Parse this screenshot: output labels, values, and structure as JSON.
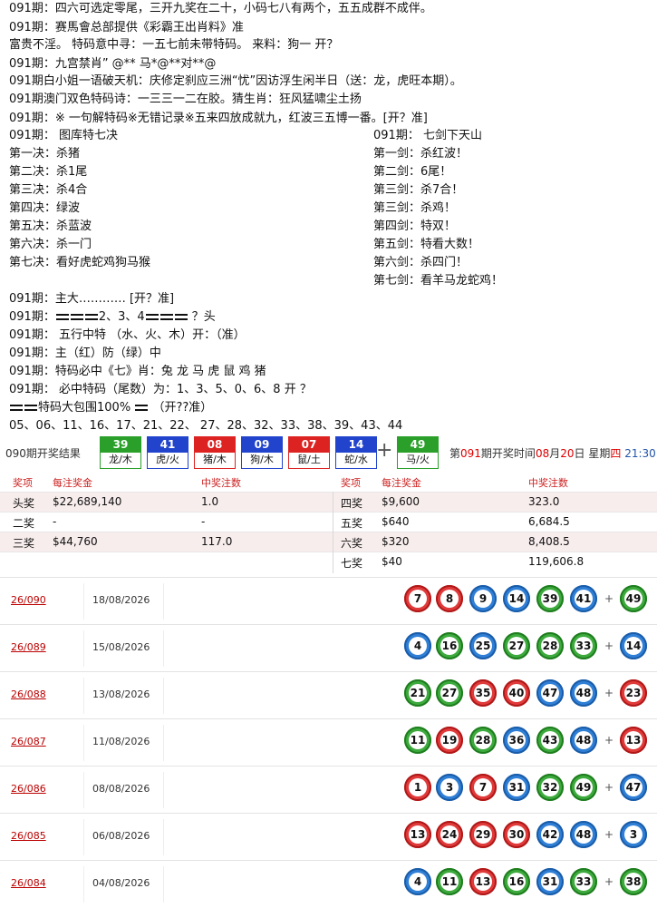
{
  "lines": [
    "091期：四六可选定零尾，三开九奖在二十，小码七八有两个，五五成群不成伴。",
    "091期：赛馬會总部提供《彩霸王出肖料》准",
    "富贵不淫。 特码意中寻：一五七前未带特码。 来料：狗一  开？",
    "091期：九宫禁肖” @** 马*@**对**@",
    "091期白小姐一语破天机：庆修定刹应三洲“忧”因访浮生闲半日（送：龙，虎旺本期）。",
    "091期澳门双色特码诗：一三三一二在胶。猜生肖：狂风猛啸尘土扬",
    "091期：※ 一句解特码※无错记录※五来四放成就九，红波三五博一番。[开？准]"
  ],
  "left_col": {
    "title": "091期：        图库特七决",
    "items": [
      "第一决：杀猪",
      "第二决：杀1尾",
      "第三决：杀4合",
      "第四决：绿波",
      "第五决：杀蓝波",
      "第六决：杀一门",
      "第七决：看好虎蛇鸡狗马猴"
    ]
  },
  "right_col": {
    "title": "091期： 七剑下天山",
    "items": [
      "第一剑：杀红波！",
      "第二剑：6尾！",
      "第三剑：杀7合！",
      "第三剑：杀鸡！",
      "第四剑：特双！",
      "第五剑：特看大数！",
      "第六剑：杀四门！",
      "第七剑：看羊马龙蛇鸡！"
    ]
  },
  "lower": {
    "l1": "091期：主大………… [开？准]",
    "l2_pre": "091期：",
    "l2_mid": "2、3、4",
    "l2_post": " ？头",
    "l3": "091期： 五行中特  （水、火、木）开：（准）",
    "l4": "091期：主（红）防（绿）中",
    "l5": "091期：特码必中《七》肖：兔 龙 马 虎 鼠 鸡  猪",
    "l6": "091期： 必中特码（尾数）为：1、3、5、0、6、8    开 ？",
    "l7_a": "特码大包围100%",
    "l7_b": " （开??准）",
    "l8": "05、06、11、16、17、21、22、 27、28、32、33、38、39、43、44"
  },
  "result": {
    "label": "090期开奖结果",
    "balls": [
      {
        "num": "39",
        "zod": "龙/木",
        "color": "#2aa02a"
      },
      {
        "num": "41",
        "zod": "虎/火",
        "color": "#2244cc"
      },
      {
        "num": "08",
        "zod": "猪/木",
        "color": "#dd2222"
      },
      {
        "num": "09",
        "zod": "狗/木",
        "color": "#2244cc"
      },
      {
        "num": "07",
        "zod": "鼠/土",
        "color": "#dd2222"
      },
      {
        "num": "14",
        "zod": "蛇/水",
        "color": "#2244cc"
      },
      {
        "num": "49",
        "zod": "马/火",
        "color": "#2aa02a"
      }
    ],
    "plus": "+",
    "info_pre": "第",
    "info_period": "091",
    "info_mid": "期开奖时间",
    "info_month": "08",
    "info_m": "月",
    "info_day": "20",
    "info_d": "日 星期",
    "info_week": "四",
    "info_time": "21:30"
  },
  "prize": {
    "headers": [
      "奖项",
      "每注奖金",
      "中奖注数",
      "奖项",
      "每注奖金",
      "中奖注数"
    ],
    "rows": [
      [
        "头奖",
        "$22,689,140",
        "1.0",
        "四奖",
        "$9,600",
        "323.0"
      ],
      [
        "二奖",
        "-",
        "-",
        "五奖",
        "$640",
        "6,684.5"
      ],
      [
        "三奖",
        "$44,760",
        "117.0",
        "六奖",
        "$320",
        "8,408.5"
      ],
      [
        "",
        "",
        "",
        "七奖",
        "$40",
        "119,606.8"
      ]
    ]
  },
  "history": [
    {
      "period": "26/090",
      "date": "18/08/2026",
      "balls": [
        [
          "7",
          "red"
        ],
        [
          "8",
          "red"
        ],
        [
          "9",
          "blue"
        ],
        [
          "14",
          "blue"
        ],
        [
          "39",
          "green"
        ],
        [
          "41",
          "blue"
        ],
        [
          "49",
          "green"
        ]
      ]
    },
    {
      "period": "26/089",
      "date": "15/08/2026",
      "balls": [
        [
          "4",
          "blue"
        ],
        [
          "16",
          "green"
        ],
        [
          "25",
          "blue"
        ],
        [
          "27",
          "green"
        ],
        [
          "28",
          "green"
        ],
        [
          "33",
          "green"
        ],
        [
          "14",
          "blue"
        ]
      ]
    },
    {
      "period": "26/088",
      "date": "13/08/2026",
      "balls": [
        [
          "21",
          "green"
        ],
        [
          "27",
          "green"
        ],
        [
          "35",
          "red"
        ],
        [
          "40",
          "red"
        ],
        [
          "47",
          "blue"
        ],
        [
          "48",
          "blue"
        ],
        [
          "23",
          "red"
        ]
      ]
    },
    {
      "period": "26/087",
      "date": "11/08/2026",
      "balls": [
        [
          "11",
          "green"
        ],
        [
          "19",
          "red"
        ],
        [
          "28",
          "green"
        ],
        [
          "36",
          "blue"
        ],
        [
          "43",
          "green"
        ],
        [
          "48",
          "blue"
        ],
        [
          "13",
          "red"
        ]
      ]
    },
    {
      "period": "26/086",
      "date": "08/08/2026",
      "balls": [
        [
          "1",
          "red"
        ],
        [
          "3",
          "blue"
        ],
        [
          "7",
          "red"
        ],
        [
          "31",
          "blue"
        ],
        [
          "32",
          "green"
        ],
        [
          "49",
          "green"
        ],
        [
          "47",
          "blue"
        ]
      ]
    },
    {
      "period": "26/085",
      "date": "06/08/2026",
      "balls": [
        [
          "13",
          "red"
        ],
        [
          "24",
          "red"
        ],
        [
          "29",
          "red"
        ],
        [
          "30",
          "red"
        ],
        [
          "42",
          "blue"
        ],
        [
          "48",
          "blue"
        ],
        [
          "3",
          "blue"
        ]
      ]
    },
    {
      "period": "26/084",
      "date": "04/08/2026",
      "balls": [
        [
          "4",
          "blue"
        ],
        [
          "11",
          "green"
        ],
        [
          "13",
          "red"
        ],
        [
          "16",
          "green"
        ],
        [
          "31",
          "blue"
        ],
        [
          "33",
          "green"
        ],
        [
          "38",
          "green"
        ]
      ]
    }
  ],
  "history_plus": "+"
}
